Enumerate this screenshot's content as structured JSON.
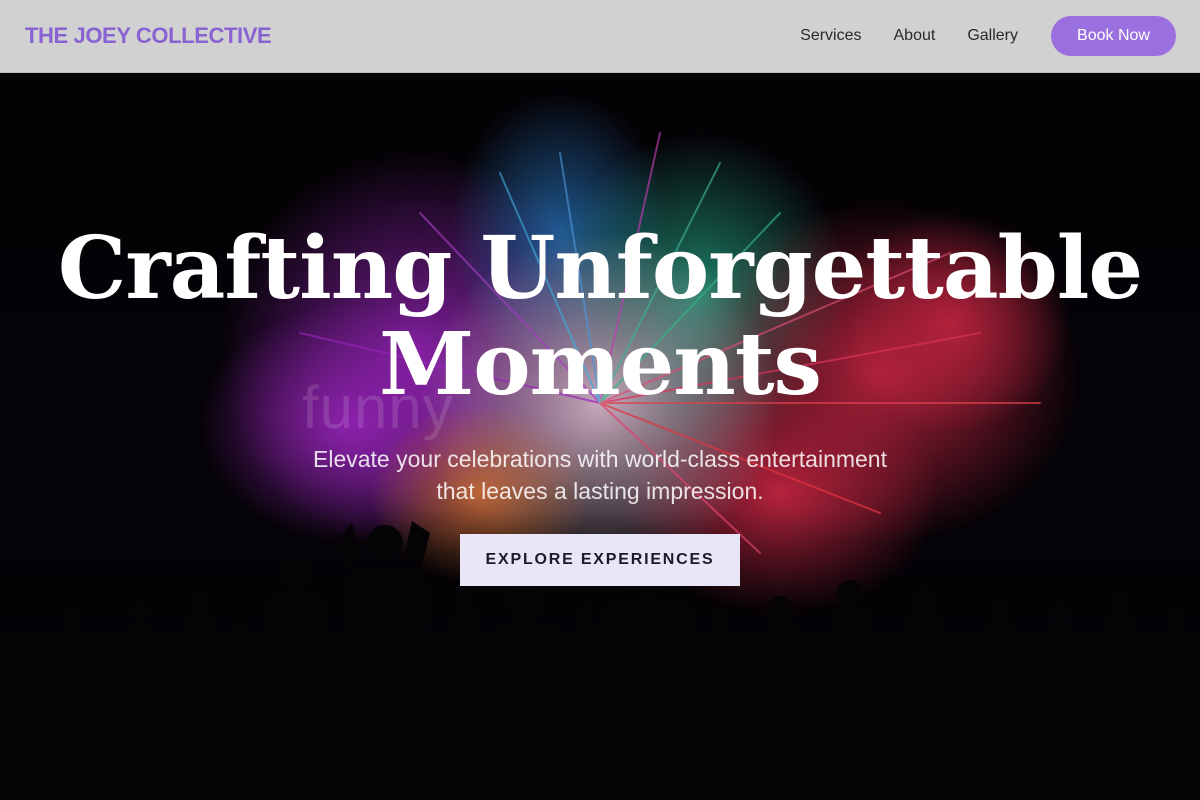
{
  "header": {
    "brand": "THE JOEY COLLECTIVE",
    "nav": [
      {
        "label": "Services"
      },
      {
        "label": "About"
      },
      {
        "label": "Gallery"
      }
    ],
    "book_label": "Book Now"
  },
  "hero": {
    "watermark": "funny",
    "headline_line1": "Crafting Unforgettable",
    "headline_line2": "Moments",
    "subtitle_line1": "Elevate your celebrations with world-class entertainment",
    "subtitle_line2": "that leaves a lasting impression.",
    "cta_label": "EXPLORE EXPERIENCES"
  },
  "colors": {
    "brand": "#8a63d2",
    "book_button": "#9a6fde",
    "header_bg": "#d1d1d1",
    "cta_bg": "#e8e6f7"
  }
}
